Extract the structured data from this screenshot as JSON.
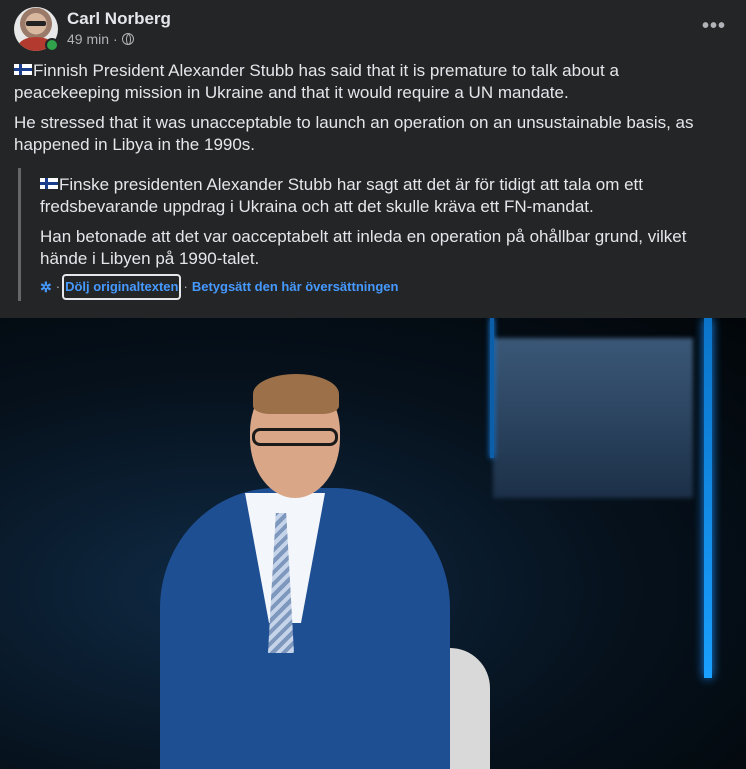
{
  "post": {
    "author": "Carl Norberg",
    "time": "49 min",
    "meta_separator": "·",
    "more_label": "•••",
    "paragraphs": [
      "Finnish President Alexander Stubb has said that it is premature to talk about a peacekeeping mission in Ukraine and that it would require a UN mandate.",
      "He stressed that it was unacceptable to launch an operation on an unsustainable basis, as happened in Libya in the 1990s."
    ],
    "translation": {
      "paragraphs": [
        "Finske presidenten Alexander Stubb har sagt att det är för tidigt att tala om ett fredsbevarande uppdrag i Ukraina och att det skulle kräva ett FN-mandat.",
        "Han betonade att det var oacceptabelt att inleda en operation på ohållbar grund, vilket hände i Libyen på 1990-talet."
      ],
      "separator": "·",
      "hide_original_label": "Dölj originaltexten",
      "rate_translation_label": "Betygsätt den här översättningen"
    }
  },
  "icons": {
    "audience": "globe-icon",
    "translation": "gear-icon",
    "flag": "finland-flag-icon"
  },
  "colors": {
    "background": "#242526",
    "text": "#e4e6eb",
    "secondary_text": "#b0b3b8",
    "link": "#4599ff",
    "online": "#31a24c"
  }
}
